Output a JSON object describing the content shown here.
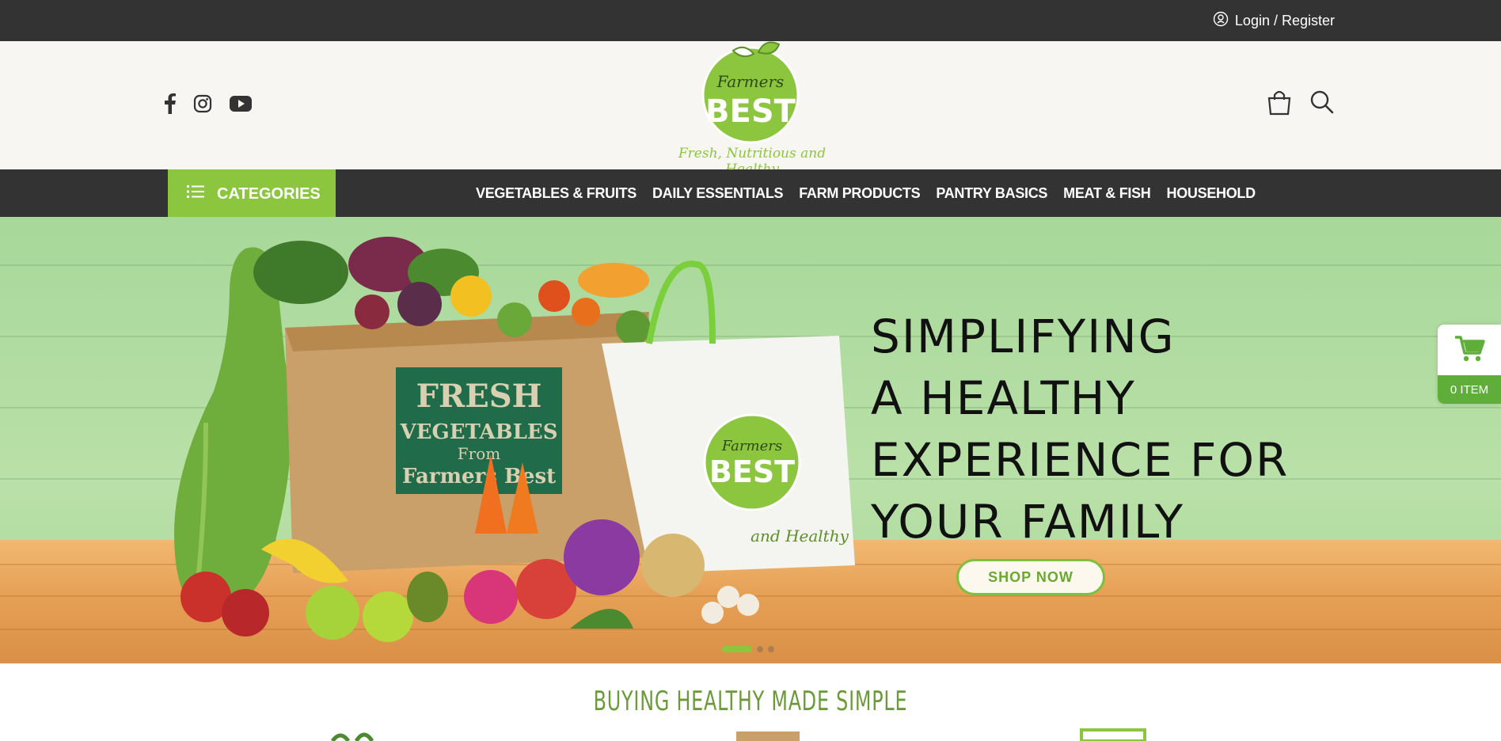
{
  "topbar": {
    "login_label": "Login / Register"
  },
  "header": {
    "social": [
      "facebook-icon",
      "instagram-icon",
      "youtube-icon"
    ],
    "logo": {
      "small": "Farmers",
      "big": "BEST",
      "tagline": "Fresh, Nutritious and Healthy"
    }
  },
  "nav": {
    "categories_label": "CATEGORIES",
    "items": [
      "VEGETABLES & FRUITS",
      "DAILY ESSENTIALS",
      "FARM PRODUCTS",
      "PANTRY BASICS",
      "MEAT & FISH",
      "HOUSEHOLD"
    ]
  },
  "hero": {
    "headline": [
      "SIMPLIFYING",
      "A HEALTHY",
      "EXPERIENCE FOR",
      "YOUR FAMILY"
    ],
    "cta_label": "SHOP NOW",
    "box_text": [
      "FRESH",
      "VEGETABLES",
      "From",
      "Farmers Best"
    ],
    "bag_text": [
      "Farmers",
      "BEST",
      "and Healthy"
    ],
    "slides": 3,
    "active_slide": 1
  },
  "cart": {
    "count_label": "0 ITEM"
  },
  "section": {
    "title": "BUYING HEALTHY MADE SIMPLE"
  },
  "colors": {
    "accent": "#8cc63f",
    "dark": "#333333",
    "cart_green": "#5fae3a",
    "title_green": "#6c9a3a"
  }
}
